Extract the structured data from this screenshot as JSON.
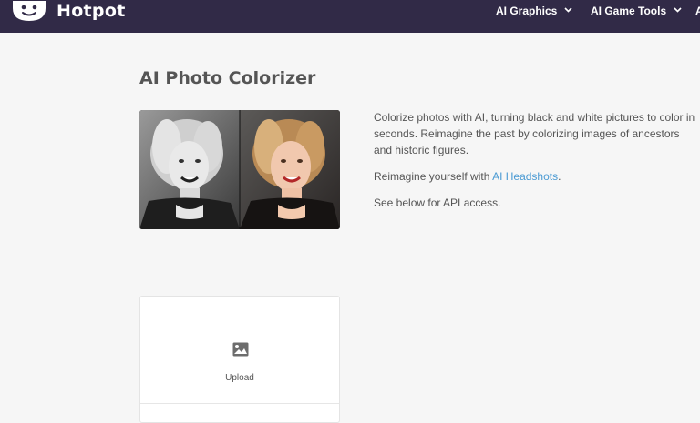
{
  "header": {
    "brand": "Hotpot",
    "nav": [
      {
        "label": "AI Graphics",
        "icon": "chevron-down"
      },
      {
        "label": "AI Game Tools",
        "icon": "chevron-down"
      },
      {
        "label": "A"
      }
    ]
  },
  "main": {
    "title": "AI Photo Colorizer",
    "paragraphs": {
      "p1": "Colorize photos with AI, turning black and white pictures to color in seconds. Reimagine the past by colorizing images of ancestors and historic figures.",
      "p2_prefix": "Reimagine yourself with ",
      "p2_link": "AI Headshots",
      "p2_suffix": ".",
      "p3": "See below for API access."
    },
    "upload": {
      "label": "Upload",
      "icon": "image-icon"
    }
  },
  "colors": {
    "header_bg": "#312a47",
    "link": "#4a9ad3",
    "page_bg": "#f6f6f6"
  }
}
